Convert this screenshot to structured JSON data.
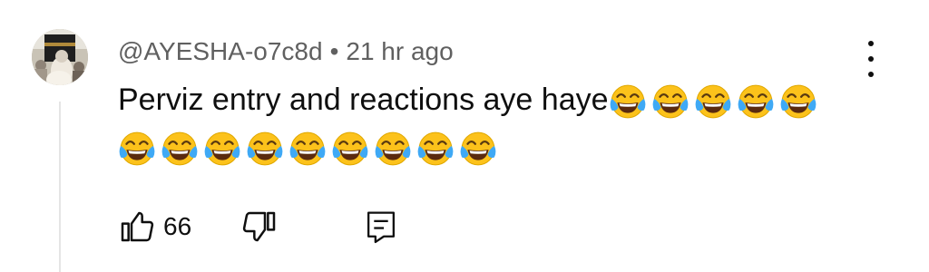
{
  "comment": {
    "author": "@AYESHA-o7c8d",
    "separator": "•",
    "timestamp": "21 hr ago",
    "text": "Perviz entry and reactions aye haye",
    "emoji": "face-with-tears-of-joy",
    "emoji_line1_count": 5,
    "emoji_line2_count": 9,
    "like_count": "66"
  },
  "icons": {
    "like": "thumbs-up-icon",
    "dislike": "thumbs-down-icon",
    "reply": "reply-icon",
    "more": "more-vert-icon"
  },
  "colors": {
    "text": "#0f0f0f",
    "secondary": "#606060",
    "emoji_face": "#fcc21b",
    "emoji_tears": "#3fa9f5"
  }
}
